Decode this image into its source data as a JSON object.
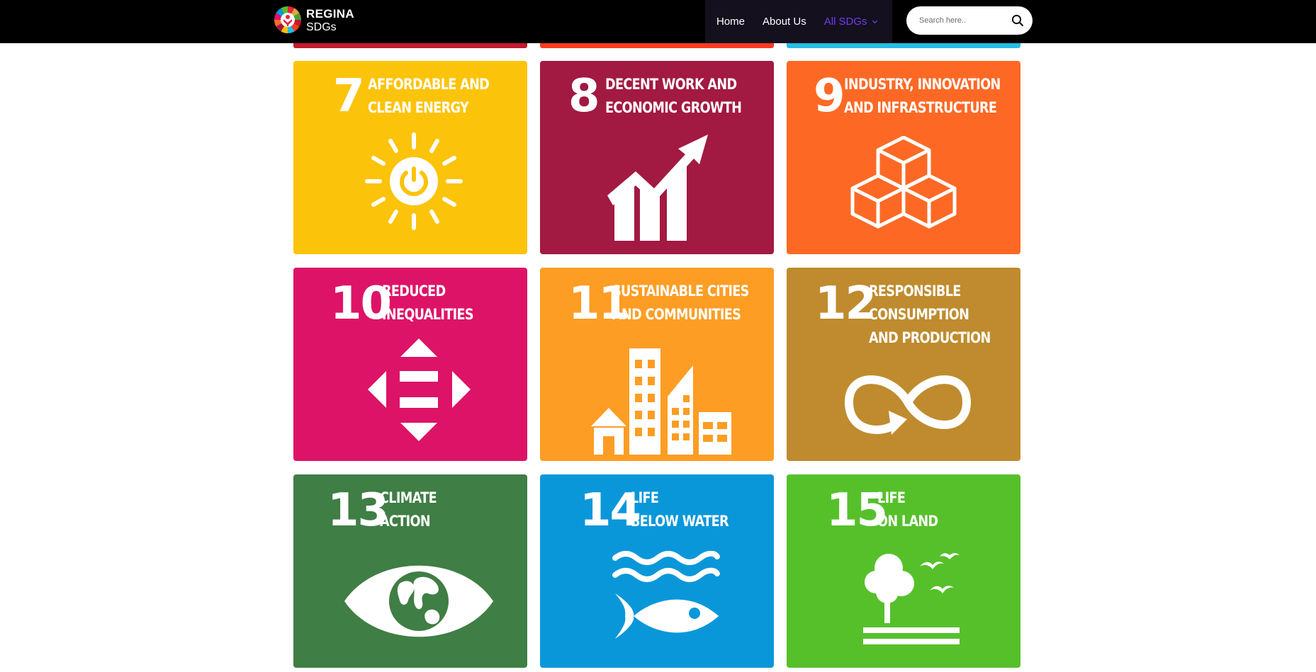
{
  "brand": {
    "name": "REGINA",
    "sub": "SDGs"
  },
  "nav": {
    "home": "Home",
    "about": "About Us",
    "all": "All SDGs"
  },
  "search": {
    "placeholder": "Search here.."
  },
  "colors": {
    "goal7": "#fcc30b",
    "goal8": "#a21942",
    "goal9": "#fd6925",
    "goal10": "#dd1367",
    "goal11": "#fd9d24",
    "goal12": "#bf8b2e",
    "goal13": "#3f7e44",
    "goal14": "#0a97d9",
    "goal15": "#56c02b",
    "nav_accent": "#6f3cf3"
  },
  "tiles": [
    {
      "number": "7",
      "title": [
        "AFFORDABLE AND",
        "CLEAN ENERGY"
      ],
      "icon": "sun-power-icon"
    },
    {
      "number": "8",
      "title": [
        "DECENT WORK AND",
        "ECONOMIC GROWTH"
      ],
      "icon": "growth-chart-icon"
    },
    {
      "number": "9",
      "title": [
        "INDUSTRY, INNOVATION",
        "AND INFRASTRUCTURE"
      ],
      "icon": "cubes-icon"
    },
    {
      "number": "10",
      "title": [
        "REDUCED",
        "INEQUALITIES"
      ],
      "icon": "equality-arrows-icon"
    },
    {
      "number": "11",
      "title": [
        "SUSTAINABLE CITIES",
        "AND COMMUNITIES"
      ],
      "icon": "city-buildings-icon"
    },
    {
      "number": "12",
      "title": [
        "RESPONSIBLE",
        "CONSUMPTION",
        "AND PRODUCTION"
      ],
      "icon": "infinity-loop-icon"
    },
    {
      "number": "13",
      "title": [
        "CLIMATE",
        "ACTION"
      ],
      "icon": "eye-globe-icon"
    },
    {
      "number": "14",
      "title": [
        "LIFE",
        "BELOW WATER"
      ],
      "icon": "fish-waves-icon"
    },
    {
      "number": "15",
      "title": [
        "LIFE",
        "ON LAND"
      ],
      "icon": "tree-birds-icon"
    }
  ]
}
